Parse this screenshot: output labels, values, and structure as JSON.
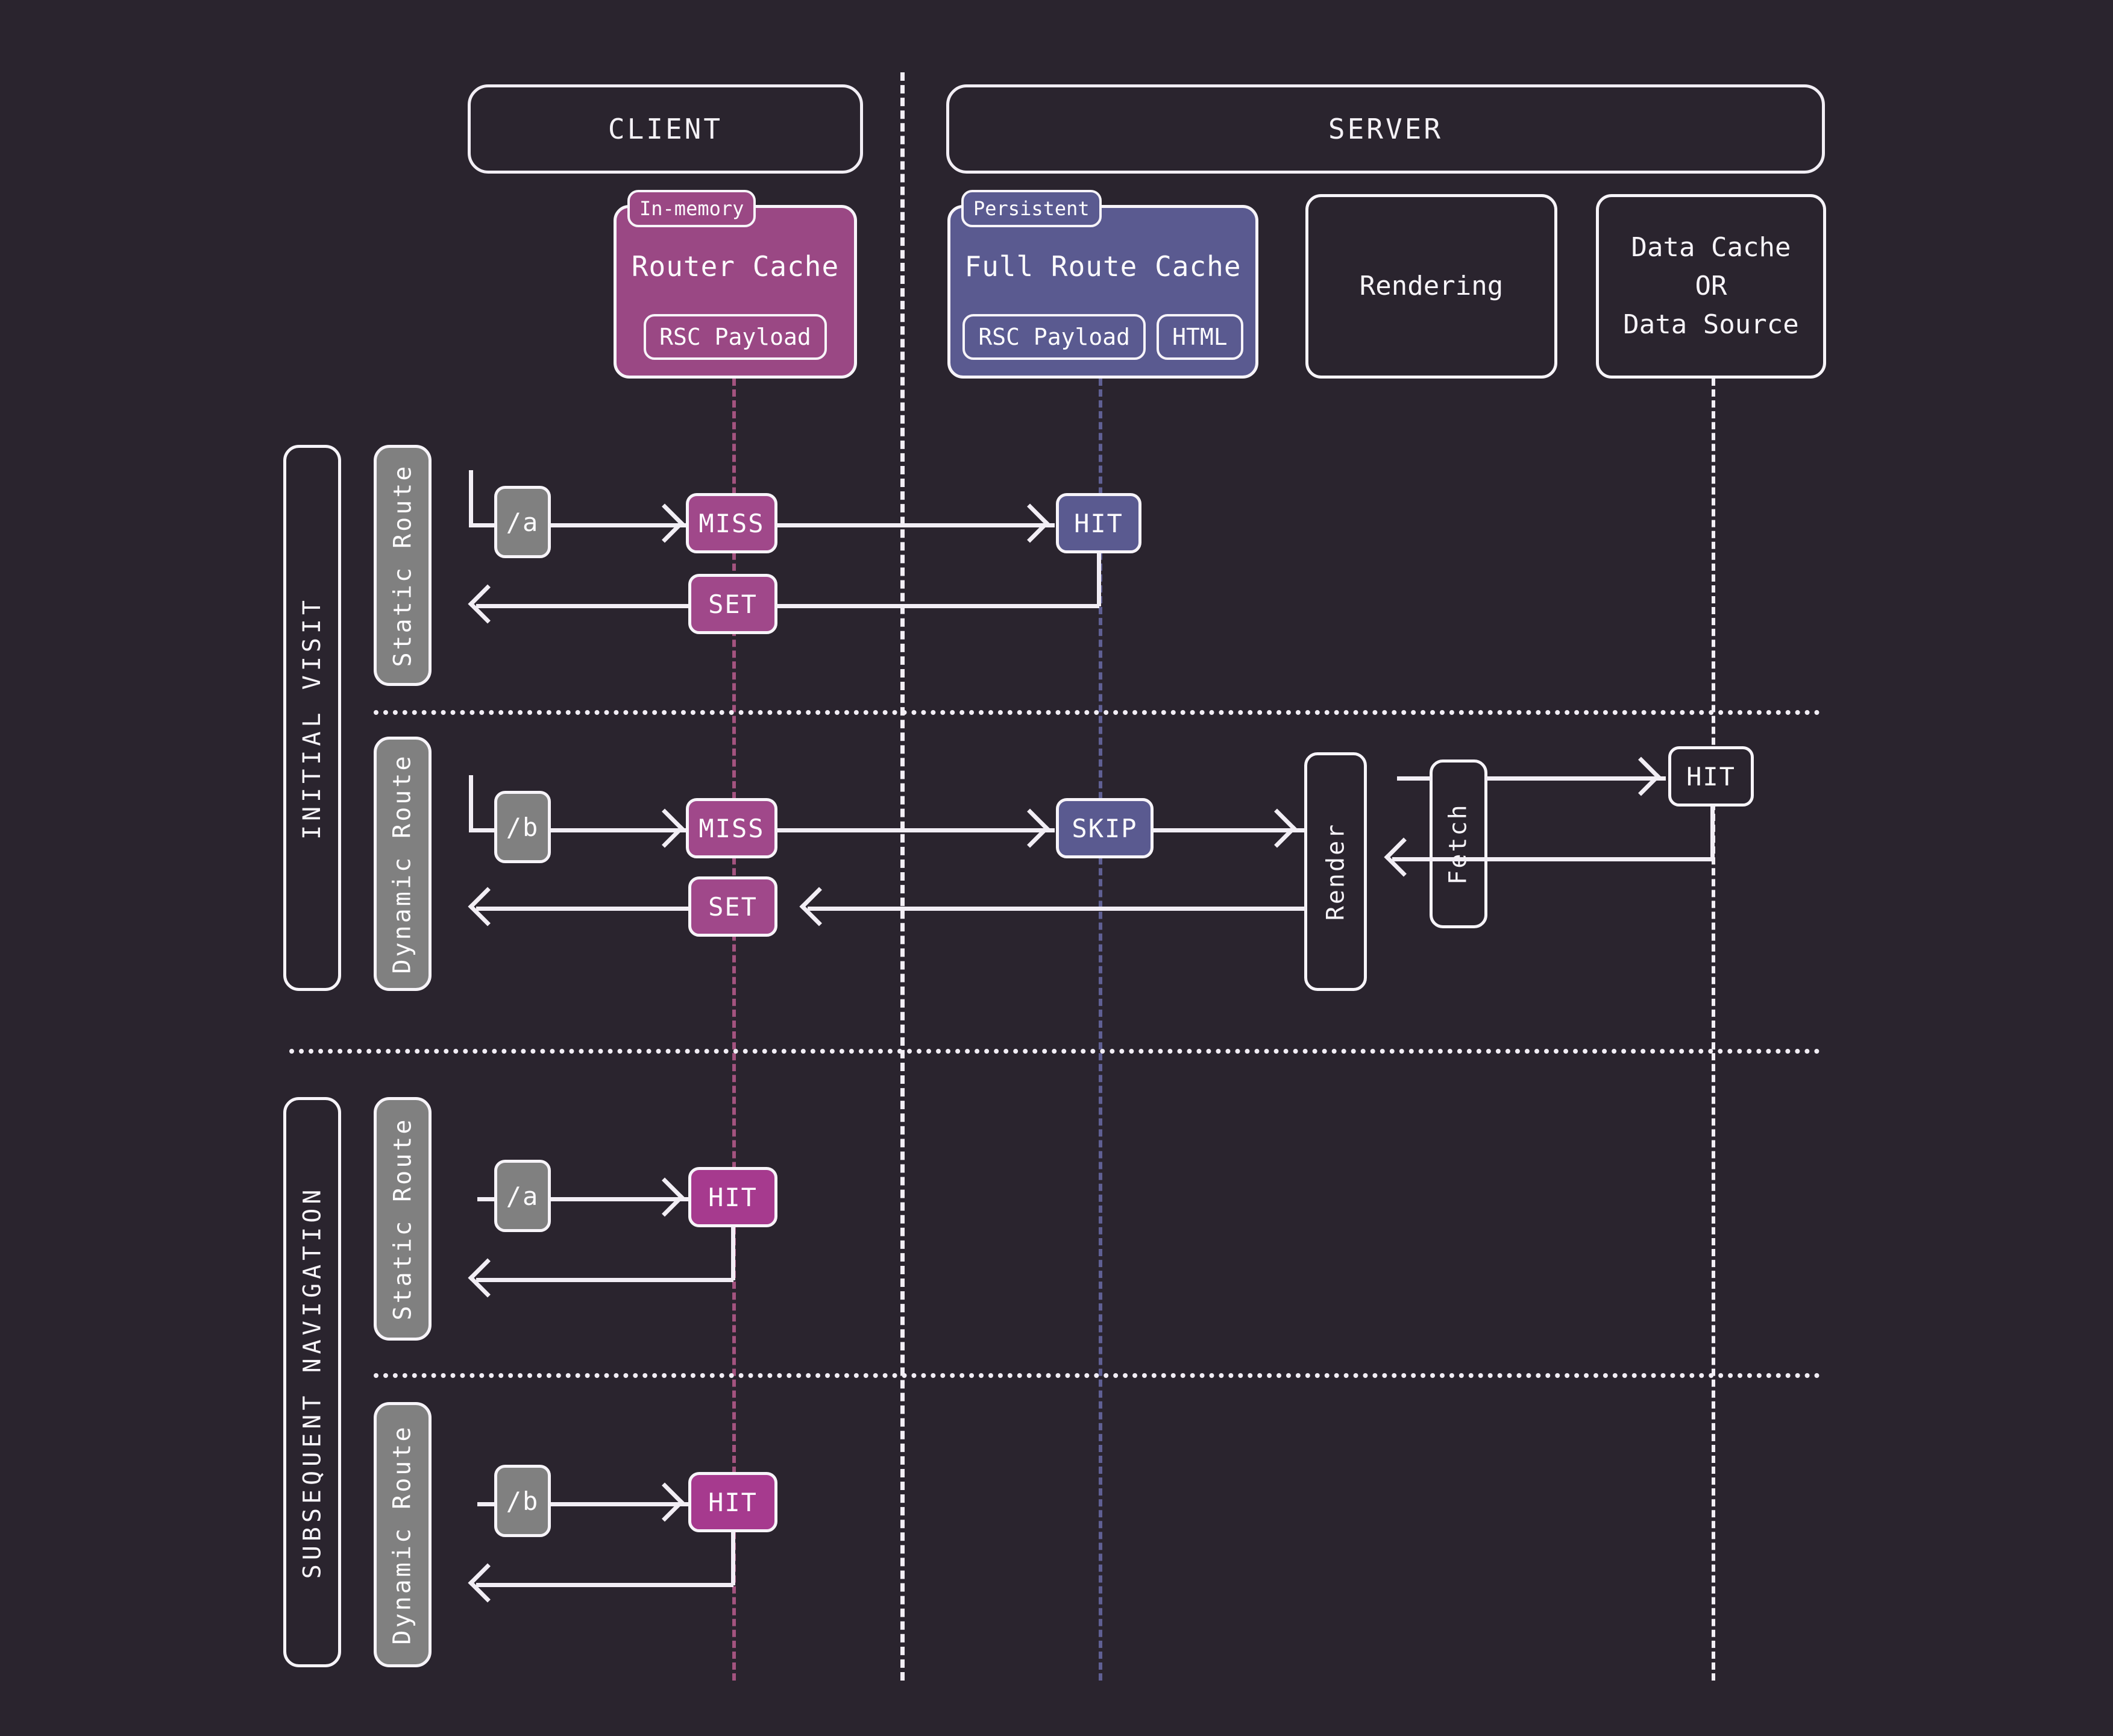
{
  "theme": {
    "background": "#2a242e",
    "stroke": "#f2eef5",
    "pink": "#9a4884",
    "magenta": "#a63a8e",
    "blue": "#5a5a90",
    "grey": "#808080"
  },
  "participants": {
    "client": "CLIENT",
    "server": "SERVER"
  },
  "caches": {
    "router": {
      "tag": "In-memory",
      "title": "Router Cache",
      "slots": [
        "RSC Payload"
      ]
    },
    "full_route": {
      "tag": "Persistent",
      "title": "Full Route Cache",
      "slots": [
        "RSC Payload",
        "HTML"
      ]
    },
    "rendering": {
      "lines": [
        "Rendering"
      ]
    },
    "data": {
      "lines": [
        "Data Cache",
        "OR",
        "Data Source"
      ]
    }
  },
  "sections": [
    {
      "label": "INITIAL VISIT"
    },
    {
      "label": "SUBSEQUENT NAVIGATION"
    }
  ],
  "lanes": {
    "initial_static": {
      "rail": "Static Route",
      "route": "/a",
      "router_state": "MISS",
      "full_route_state": "HIT",
      "set_state": "SET"
    },
    "initial_dynamic": {
      "rail": "Dynamic Route",
      "route": "/b",
      "router_state": "MISS",
      "full_route_state": "SKIP",
      "render": "Render",
      "fetch": "Fetch",
      "data_state": "HIT",
      "set_state": "SET"
    },
    "subsequent_static": {
      "rail": "Static Route",
      "route": "/a",
      "router_state": "HIT"
    },
    "subsequent_dynamic": {
      "rail": "Dynamic Route",
      "route": "/b",
      "router_state": "HIT"
    }
  }
}
